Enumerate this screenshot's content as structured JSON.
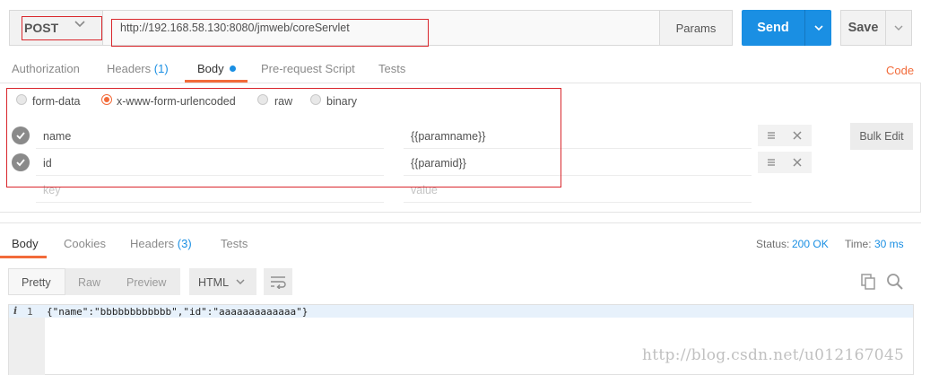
{
  "request": {
    "method": "POST",
    "url": "http://192.168.58.130:8080/jmweb/coreServlet",
    "params_label": "Params",
    "send_label": "Send",
    "save_label": "Save"
  },
  "request_tabs": [
    {
      "label": "Authorization"
    },
    {
      "label": "Headers"
    },
    {
      "label": "Body"
    },
    {
      "label": "Pre-request Script"
    },
    {
      "label": "Tests"
    }
  ],
  "headers_count": "(1)",
  "code_link": "Code",
  "body_types": [
    {
      "label": "form-data",
      "selected": false
    },
    {
      "label": "x-www-form-urlencoded",
      "selected": true
    },
    {
      "label": "raw",
      "selected": false
    },
    {
      "label": "binary",
      "selected": false
    }
  ],
  "params": [
    {
      "key": "name",
      "value": "{{paramname}}",
      "enabled": true
    },
    {
      "key": "id",
      "value": "{{paramid}}",
      "enabled": true
    }
  ],
  "placeholders": {
    "key": "key",
    "value": "value"
  },
  "bulk_edit_label": "Bulk Edit",
  "response_tabs": [
    {
      "label": "Body"
    },
    {
      "label": "Cookies"
    },
    {
      "label": "Headers"
    },
    {
      "label": "Tests"
    }
  ],
  "response_headers_count": "(3)",
  "status": {
    "label": "Status:",
    "value": "200 OK"
  },
  "time": {
    "label": "Time:",
    "value": "30 ms"
  },
  "view_modes": [
    {
      "label": "Pretty"
    },
    {
      "label": "Raw"
    },
    {
      "label": "Preview"
    }
  ],
  "format": "HTML",
  "editor": {
    "gutter_icon": "i",
    "line_number": "1",
    "line": "{\"name\":\"bbbbbbbbbbbb\",\"id\":\"aaaaaaaaaaaaa\"}"
  },
  "watermark": "http://blog.csdn.net/u012167045",
  "colors": {
    "accent": "#f26b3a",
    "send": "#1a8fe3",
    "highlight": "#d9262c"
  }
}
